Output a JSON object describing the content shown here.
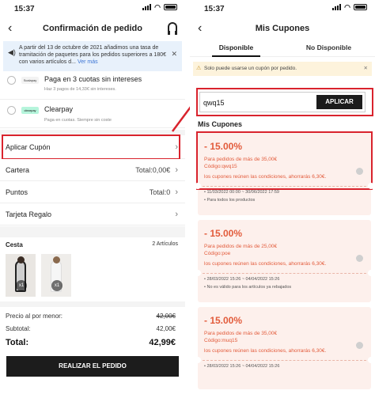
{
  "left": {
    "status": {
      "time": "15:37"
    },
    "nav": {
      "title": "Confirmación de pedido"
    },
    "notice": {
      "text": "A partir del 13 de octubre de 2021 añadimos una tasa de tramitación de paquetes para los pedidos superiores a 180€ con varios artículos d...",
      "more": "Ver más"
    },
    "payments": [
      {
        "title": "Paga en 3 cuotas sin intereses",
        "sub": "Haz 3 pagos de 14,33€ sin intereses.",
        "logo": "Scalapay"
      },
      {
        "title": "Clearpay",
        "sub": "Paga en cuotas. Siempre sin coste",
        "logo": "clearpay"
      }
    ],
    "rows": {
      "coupon": "Aplicar Cupón",
      "wallet": "Cartera",
      "wallet_val": "Total:0,00€",
      "points": "Puntos",
      "points_val": "Total:0",
      "gift": "Tarjeta Regalo"
    },
    "cart": {
      "title": "Cesta",
      "count": "2 Artículos",
      "item_qty": [
        "x1",
        "x1"
      ]
    },
    "summary": {
      "retail_label": "Precio al por menor:",
      "retail_val": "42,00€",
      "subtotal_label": "Subtotal:",
      "subtotal_val": "42,00€",
      "total_label": "Total:",
      "total_val": "42,99€"
    },
    "cta": "REALIZAR EL PEDIDO"
  },
  "right": {
    "nav": {
      "title": "Mis Cupones"
    },
    "tabs": [
      "Disponible",
      "No Disponible"
    ],
    "info": "Solo puede usarse un cupón por pedido.",
    "code": {
      "value": "qwq15",
      "apply": "APLICAR"
    },
    "list_title": "Mis Cupones",
    "coupons": [
      {
        "pct": "- 15.00%",
        "min": "Para pedidos de más de 35,00€",
        "code": "Código:qwq15",
        "save": "los cupones reúnen las condiciones, ahorrarás 6,30€.",
        "dates": "11/03/2022 00:00 ~ 30/06/2022 17:59",
        "scope": "Para todos los productos"
      },
      {
        "pct": "- 15.00%",
        "min": "Para pedidos de más de 25,00€",
        "code": "Código:poe",
        "save": "los cupones reúnen las condiciones, ahorrarás 6,30€.",
        "dates": "28/03/2022 15:26 ~ 04/04/2022 15:26",
        "scope": "No es válido para los artículos ya rebajados"
      },
      {
        "pct": "- 15.00%",
        "min": "Para pedidos de más de 35,00€",
        "code": "Código:muq15",
        "save": "los cupones reúnen las condiciones, ahorrarás 6,30€.",
        "dates": "28/03/2022 15:26 ~ 04/04/2022 15:26",
        "scope": ""
      }
    ]
  },
  "colors": {
    "highlight": "#d9232d",
    "coupon_text": "#e25b3b",
    "coupon_bg": "#fdf0ec"
  }
}
